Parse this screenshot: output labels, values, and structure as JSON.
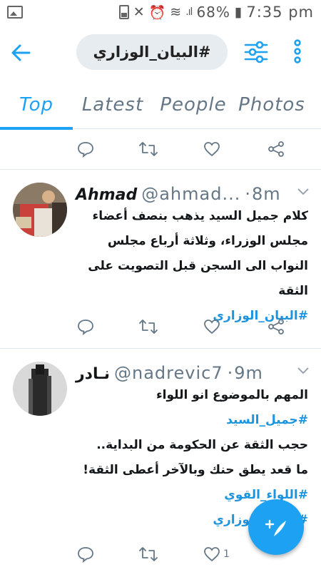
{
  "status_bar": {
    "battery": "68%",
    "time": "7:35 pm"
  },
  "search": {
    "query": "#البيان_الوزاري"
  },
  "tabs": [
    {
      "label": "Top"
    },
    {
      "label": "Latest"
    },
    {
      "label": "People"
    },
    {
      "label": "Photos"
    }
  ],
  "tweets": [
    {
      "name": "Ahmad",
      "handle": "@ahmad...",
      "time": "8m",
      "lines": [
        "كلام جميل السيد يذهب بنصف أعضاء",
        "مجلس الوزراء، وثلاثة أرباع مجلس",
        "النواب الى السجن قبل التصويت على",
        "الثقة"
      ],
      "hashtag": "#البيان_الوزاري"
    },
    {
      "name": "نـادر",
      "handle": "@nadrevic7",
      "time": "9m",
      "line1": "المهم بالموضوع انو اللواء",
      "hashtag1": "#جميل_السيد",
      "line2": "حجب الثقة عن الحكومة من البداية..",
      "line3": "ما قعد يطق حنك وبالآخر أعطى الثقة!",
      "hashtag2": "#اللواء_القوي",
      "hashtag3": "#البيان_الوزاري",
      "like_count": "1"
    }
  ],
  "colors": {
    "accent": "#1da1f2",
    "muted": "#657786"
  }
}
